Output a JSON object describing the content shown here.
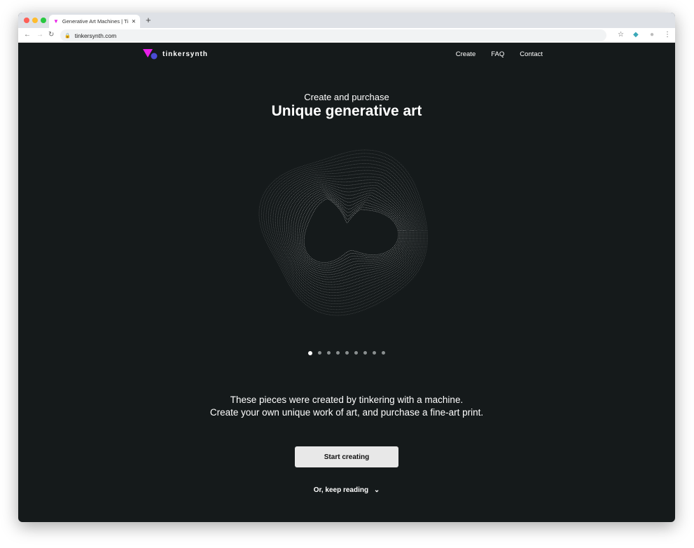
{
  "browser": {
    "tab_title": "Generative Art Machines | Tinkersynth",
    "url": "tinkersynth.com"
  },
  "nav": {
    "brand": "tinkersynth",
    "links": [
      "Create",
      "FAQ",
      "Contact"
    ]
  },
  "hero": {
    "subtitle": "Create and purchase",
    "title": "Unique generative art",
    "slide_count": 9,
    "active_slide": 1
  },
  "description": {
    "line1": "These pieces were created by tinkering with a machine.",
    "line2": "Create your own unique work of art, and purchase a fine-art print."
  },
  "cta": {
    "start_label": "Start creating",
    "keep_reading_label": "Or, keep reading"
  },
  "colors": {
    "background": "#151a1b",
    "brand_pink": "#e91ee8",
    "brand_blue": "#4b4bd6"
  }
}
